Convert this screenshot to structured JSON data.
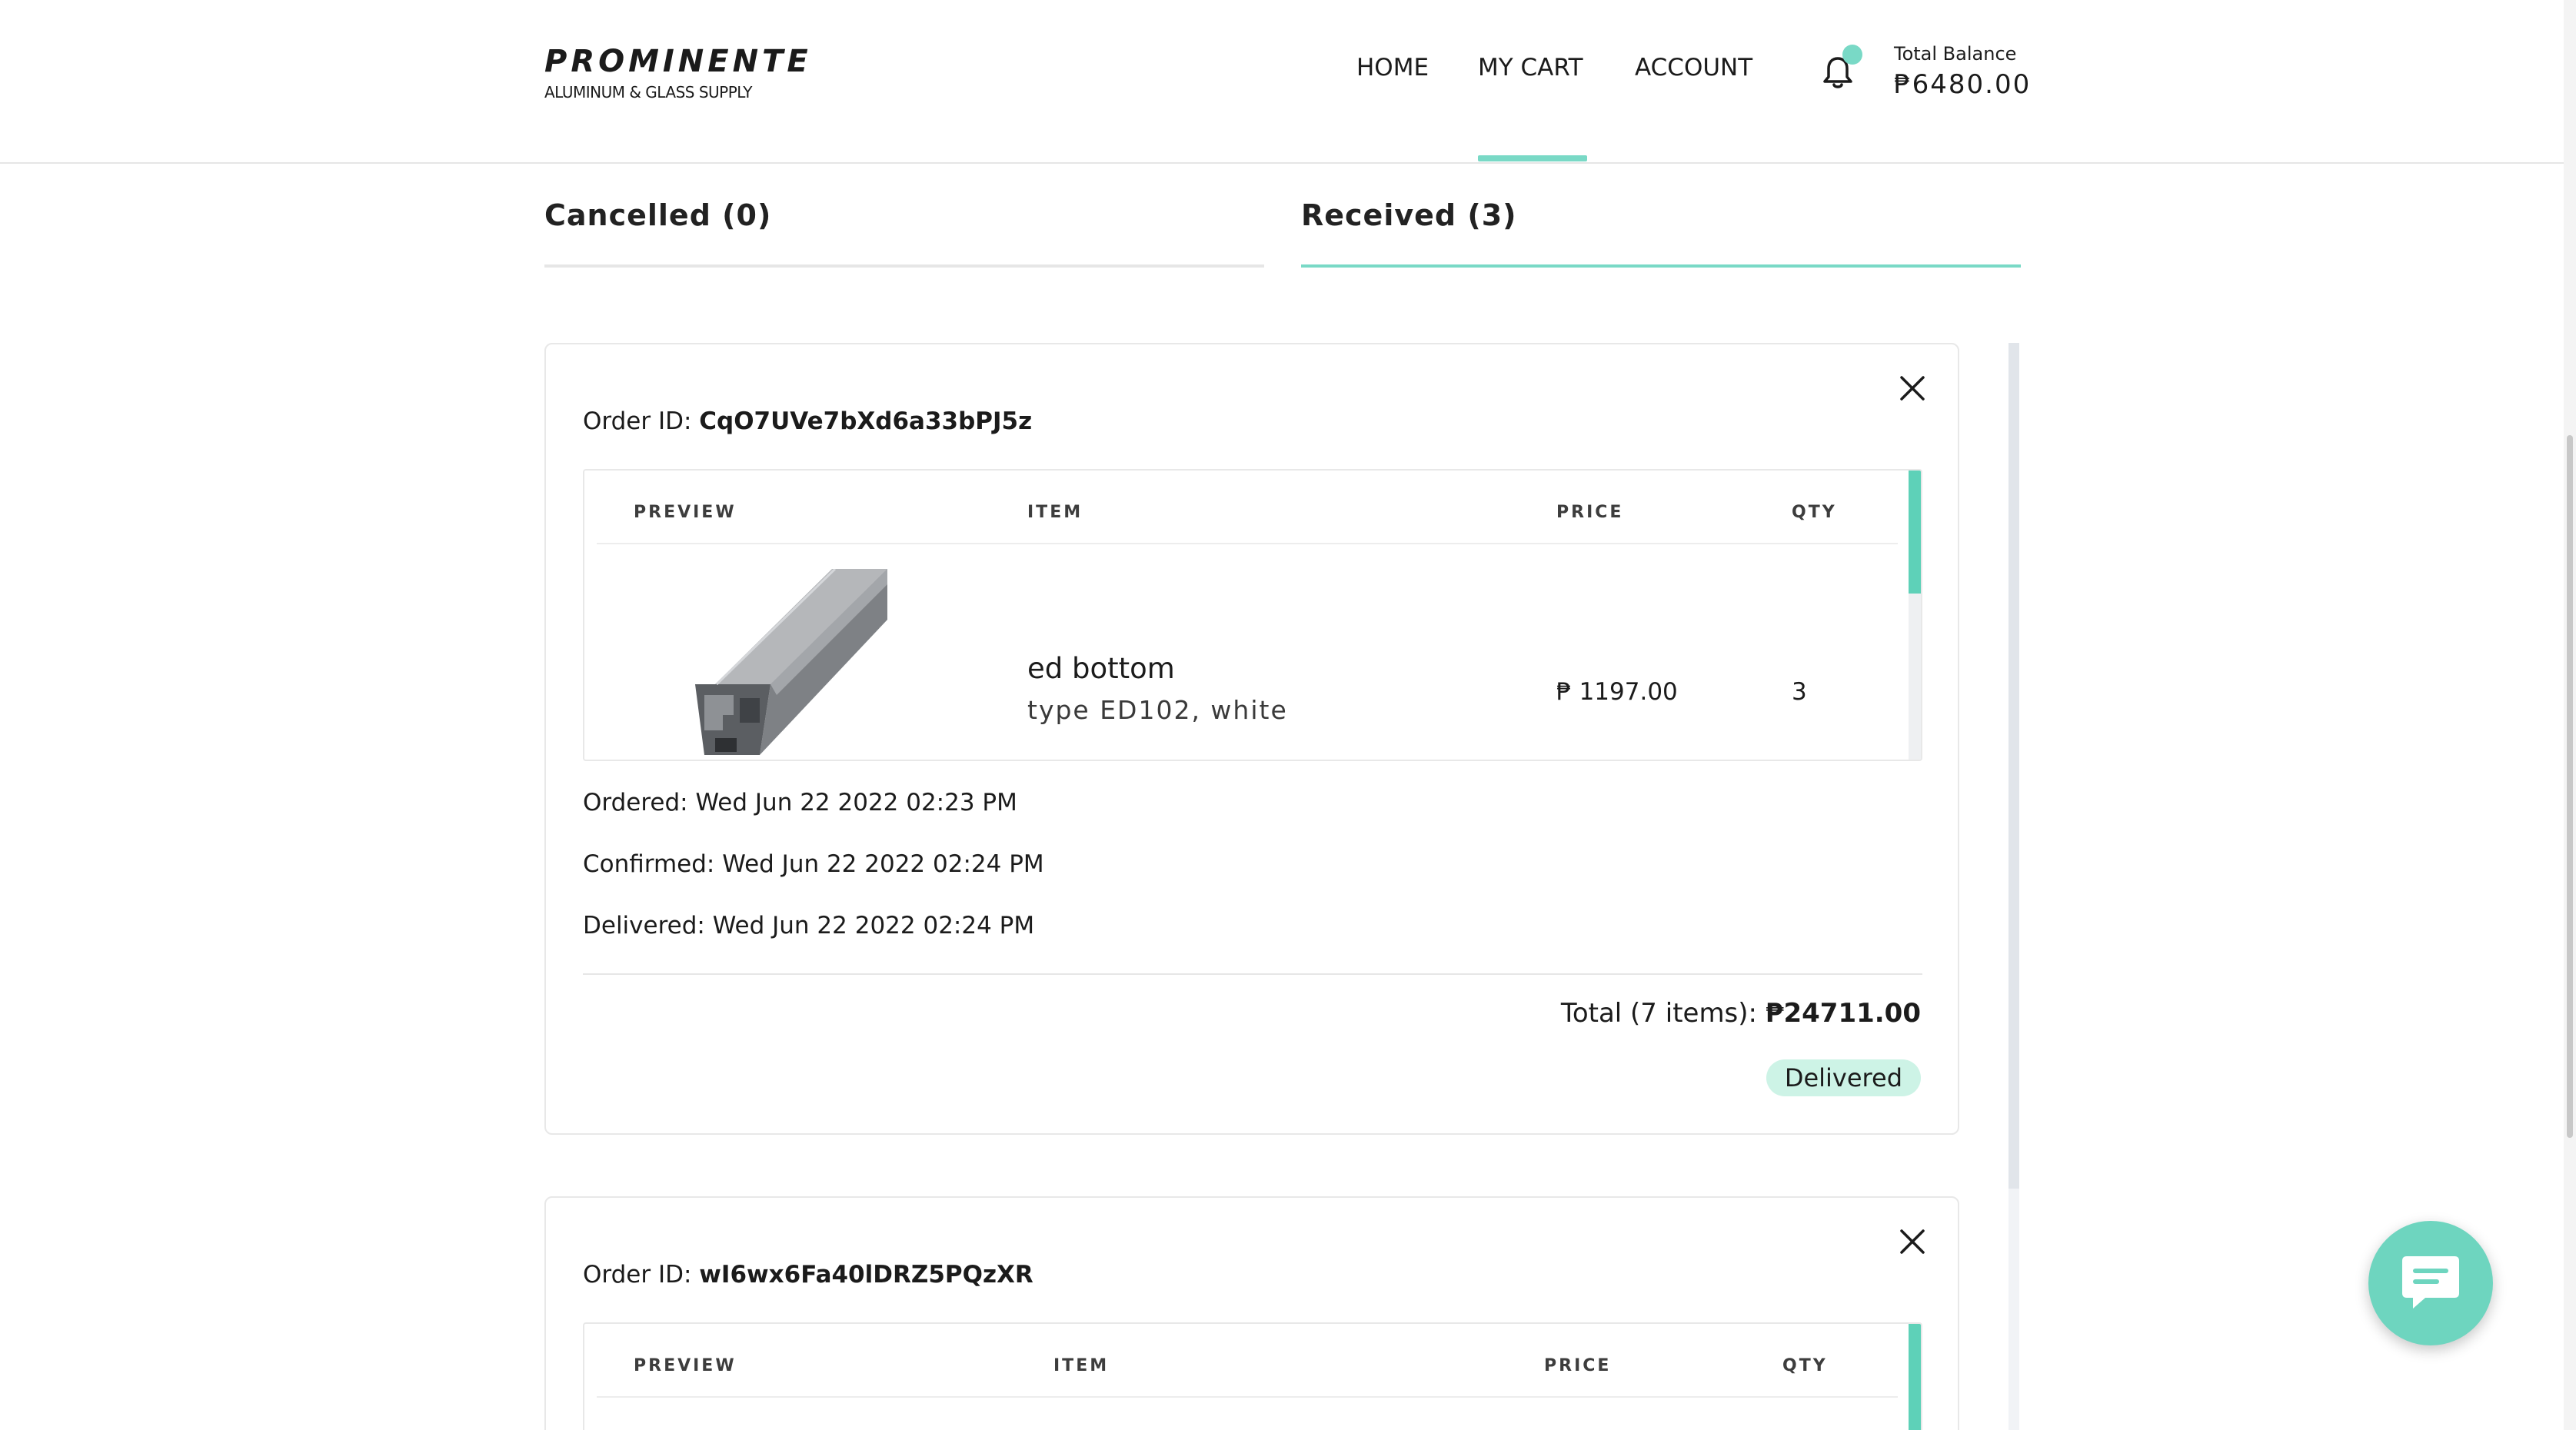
{
  "header": {
    "logo_name": "PROMINENTE",
    "logo_sub": "ALUMINUM & GLASS SUPPLY",
    "nav": [
      {
        "label": "HOME"
      },
      {
        "label": "MY CART"
      },
      {
        "label": "ACCOUNT"
      }
    ],
    "active_nav": "MY CART",
    "notification_icon": "bell-icon",
    "balance_label": "Total Balance",
    "balance_value": "₱6480.00"
  },
  "tabs": [
    {
      "label": "Cancelled (0)",
      "active": false
    },
    {
      "label": "Received (3)",
      "active": true
    }
  ],
  "colors": {
    "accent": "#79d9c6",
    "badge_bg": "#cdf3e6",
    "table_scroll": "#5ed1b8"
  },
  "orders": [
    {
      "id_label": "Order ID: ",
      "id_value": "CqO7UVe7bXd6a33bPJ5z",
      "headers": {
        "preview": "PREVIEW",
        "item": "ITEM",
        "price": "PRICE",
        "qty": "QTY"
      },
      "items": [
        {
          "name": "ed bottom",
          "desc": "type ED102, white",
          "price": "₱ 1197.00",
          "qty": "3",
          "preview_icon": "aluminum-profile-image"
        }
      ],
      "ordered": "Ordered: Wed Jun 22 2022 02:23 PM",
      "confirmed": "Confirmed: Wed Jun 22 2022 02:24 PM",
      "delivered": "Delivered: Wed Jun 22 2022 02:24 PM",
      "total_label": "Total (7 items): ",
      "total_value": "₱24711.00",
      "status": "Delivered"
    },
    {
      "id_label": "Order ID: ",
      "id_value": "wI6wx6Fa40lDRZ5PQzXR",
      "headers": {
        "preview": "PREVIEW",
        "item": "ITEM",
        "price": "PRICE",
        "qty": "QTY"
      }
    }
  ],
  "chat_icon": "chat-bubble-icon"
}
